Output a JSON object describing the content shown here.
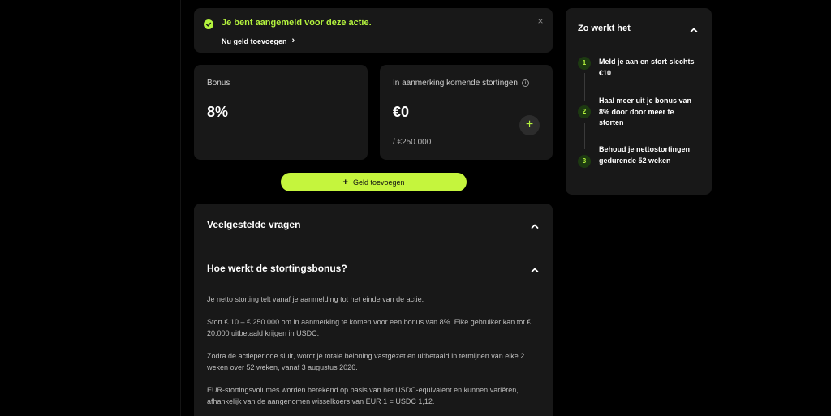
{
  "banner": {
    "message": "Je bent aangemeld voor deze actie.",
    "link_label": "Nu geld toevoegen",
    "close_glyph": "×"
  },
  "bonus_card": {
    "label": "Bonus",
    "value": "8%"
  },
  "eligible_card": {
    "label": "In aanmerking komende stortingen",
    "value": "€0",
    "limit": "/ €250.000"
  },
  "add_button": {
    "label": "Geld toevoegen"
  },
  "faq": {
    "title": "Veelgestelde vragen",
    "question": "Hoe werkt de stortingsbonus?",
    "paragraphs": [
      "Je netto storting telt vanaf je aanmelding tot het einde van de actie.",
      "Stort € 10 – € 250.000 om in aanmerking te komen voor een bonus van 8%. Elke gebruiker kan tot € 20.000 uitbetaald krijgen in USDC.",
      "Zodra de actieperiode sluit, wordt je totale beloning vastgezet en uitbetaald in termijnen van elke 2 weken over 52 weken, vanaf 3 augustus 2026.",
      "EUR-stortingsvolumes worden berekend op basis van het USDC-equivalent en kunnen variëren, afhankelijk van de aangenomen wisselkoers van EUR 1 = USDC 1,12."
    ]
  },
  "how_it_works": {
    "title": "Zo werkt het",
    "steps": [
      {
        "num": "1",
        "text": "Meld je aan en stort slechts €10"
      },
      {
        "num": "2",
        "text": "Haal meer uit je bonus van 8% door door meer te storten"
      },
      {
        "num": "3",
        "text": "Behoud je nettostortingen gedurende 52 weken"
      }
    ]
  },
  "colors": {
    "accent": "#b4f33e",
    "button": "#c5f53d",
    "card": "#181818",
    "background": "#000000"
  }
}
